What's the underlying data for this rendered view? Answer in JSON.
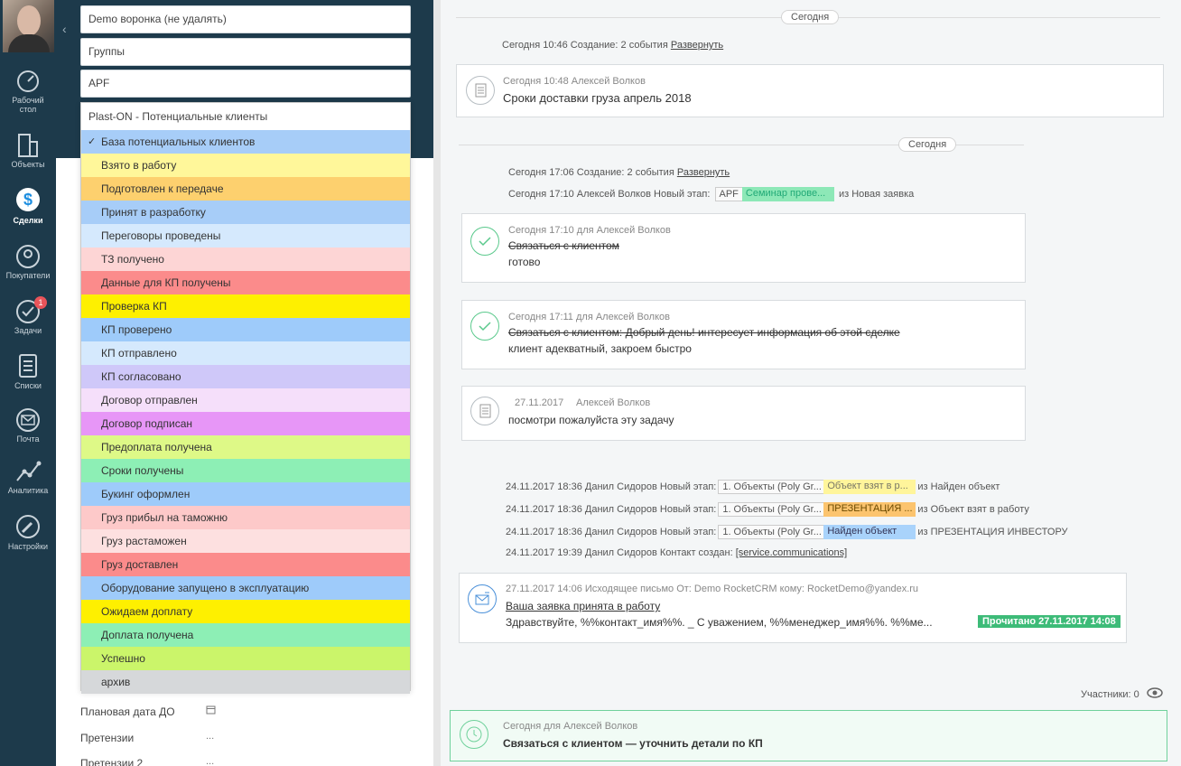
{
  "nav": {
    "items": [
      {
        "label": "Рабочий\nстол",
        "l1": "Рабочий",
        "l2": "стол",
        "icon": "dashboard-icon"
      },
      {
        "label": "Объекты",
        "icon": "buildings-icon"
      },
      {
        "label": "Сделки",
        "icon": "dollar-icon"
      },
      {
        "label": "Покупатели",
        "icon": "users-icon"
      },
      {
        "label": "Задачи",
        "icon": "check-circle-icon",
        "badge": "1"
      },
      {
        "label": "Списки",
        "icon": "list-icon"
      },
      {
        "label": "Почта",
        "icon": "mail-icon"
      },
      {
        "label": "Аналитика",
        "icon": "analytics-icon"
      },
      {
        "label": "Настройки",
        "icon": "wrench-icon"
      }
    ]
  },
  "filters": {
    "funnel": "Demo воронка (не удалять)",
    "groups": "Группы",
    "apf": "APF"
  },
  "dropdown": {
    "header": "Plast-ON - Потенциальные клиенты",
    "check": "✓",
    "items": [
      {
        "label": "База потенциальных клиентов",
        "color": "#a7cdf8",
        "selected": true
      },
      {
        "label": "Взято в работу",
        "color": "#fff79a"
      },
      {
        "label": "Подготовлен к передаче",
        "color": "#fdd06e"
      },
      {
        "label": "Принят в разработку",
        "color": "#a7cdf8"
      },
      {
        "label": "Переговоры проведены",
        "color": "#d5e9fd"
      },
      {
        "label": "ТЗ получено",
        "color": "#fdd5d5"
      },
      {
        "label": "Данные для КП получены",
        "color": "#fb8b8b"
      },
      {
        "label": "Проверка КП",
        "color": "#fef000"
      },
      {
        "label": "КП проверено",
        "color": "#9ecbfa"
      },
      {
        "label": "КП отправлено",
        "color": "#d5e9fd"
      },
      {
        "label": "КП согласовано",
        "color": "#cfc8f9"
      },
      {
        "label": "Договор отправлен",
        "color": "#f5dffa"
      },
      {
        "label": "Договор подписан",
        "color": "#e796f7"
      },
      {
        "label": "Предоплата получена",
        "color": "#def987"
      },
      {
        "label": "Сроки получены",
        "color": "#8defb5"
      },
      {
        "label": "Букинг оформлен",
        "color": "#9ecbfa"
      },
      {
        "label": "Груз прибыл на таможню",
        "color": "#fdc9c9"
      },
      {
        "label": "Груз растаможен",
        "color": "#fde0e0"
      },
      {
        "label": "Груз доставлен",
        "color": "#fb8b8b"
      },
      {
        "label": "Оборудование запущено в эксплуатацию",
        "color": "#9ecbfa"
      },
      {
        "label": "Ожидаем доплату",
        "color": "#fef000"
      },
      {
        "label": "Доплата получена",
        "color": "#8defb5"
      },
      {
        "label": "Успешно",
        "color": "#cbf56a"
      },
      {
        "label": "архив",
        "color": "#d6d8da"
      }
    ]
  },
  "fields": [
    {
      "label": "Плановая дата ДО",
      "value": "calendar"
    },
    {
      "label": "Претензии",
      "value": "..."
    },
    {
      "label": "Претензии 2",
      "value": "..."
    }
  ],
  "timeline": {
    "date1": "Сегодня",
    "create1": {
      "text": "Сегодня 10:46 Создание: 2 события",
      "link": "Развернуть"
    },
    "note1": {
      "meta": "Сегодня 10:48 Алексей Волков",
      "text": "Сроки доставки груза апрель 2018"
    },
    "date2": "Сегодня",
    "create2": {
      "text": "Сегодня 17:06 Создание: 2 события",
      "link": "Развернуть"
    },
    "stage1": {
      "prefix": "Сегодня 17:10 Алексей Волков  Новый этап:",
      "tag1": "APF",
      "tag2": "Семинар прове...",
      "suffix": "из Новая заявка"
    },
    "task1": {
      "meta": "Сегодня 17:10  для Алексей Волков",
      "title": "Связаться с клиентом",
      "result": "готово"
    },
    "task2": {
      "meta": "Сегодня 17:11  для Алексей Волков",
      "title": "Связаться с клиентом: Добрый день! интересует информация об этой сделке",
      "result": "клиент адекватный, закроем быстро"
    },
    "note2": {
      "meta_date": "27.11.2017",
      "meta_user": "Алексей Волков",
      "text": "посмотри пожалуйста эту задачу"
    },
    "stages": [
      {
        "prefix": "24.11.2017 18:36 Данил Сидоров  Новый этап:",
        "tag1": "1. Объекты (Poly Gr...",
        "tag2": "Объект взят в р...",
        "tag2color": "yellow",
        "suffix": "из Найден объект"
      },
      {
        "prefix": "24.11.2017 18:36 Данил Сидоров  Новый этап:",
        "tag1": "1. Объекты (Poly Gr...",
        "tag2": "ПРЕЗЕНТАЦИЯ ...",
        "tag2color": "orange",
        "suffix": "из Объект взят в работу"
      },
      {
        "prefix": "24.11.2017 18:36 Данил Сидоров  Новый этап:",
        "tag1": "1. Объекты (Poly Gr...",
        "tag2": "Найден объект",
        "tag2color": "blue",
        "suffix": "из ПРЕЗЕНТАЦИЯ ИНВЕСТОРУ"
      }
    ],
    "contact": {
      "text": "24.11.2017 19:39 Данил Сидоров  Контакт создан:",
      "link": "[service.communications]"
    },
    "mail": {
      "meta": "27.11.2017 14:06 Исходящее письмо От: Demo RocketCRM кому: RocketDemo@yandex.ru",
      "subject": "Ваша заявка принята в работу",
      "body": "Здравствуйте, %%контакт_имя%%. _ С уважением, %%менеджер_имя%%. %%ме...",
      "badge": "Прочитано 27.11.2017 14:08"
    },
    "participants": "Участники: 0",
    "current_task": {
      "meta": "Сегодня для Алексей Волков",
      "text": "Связаться с клиентом — уточнить детали по КП"
    }
  }
}
